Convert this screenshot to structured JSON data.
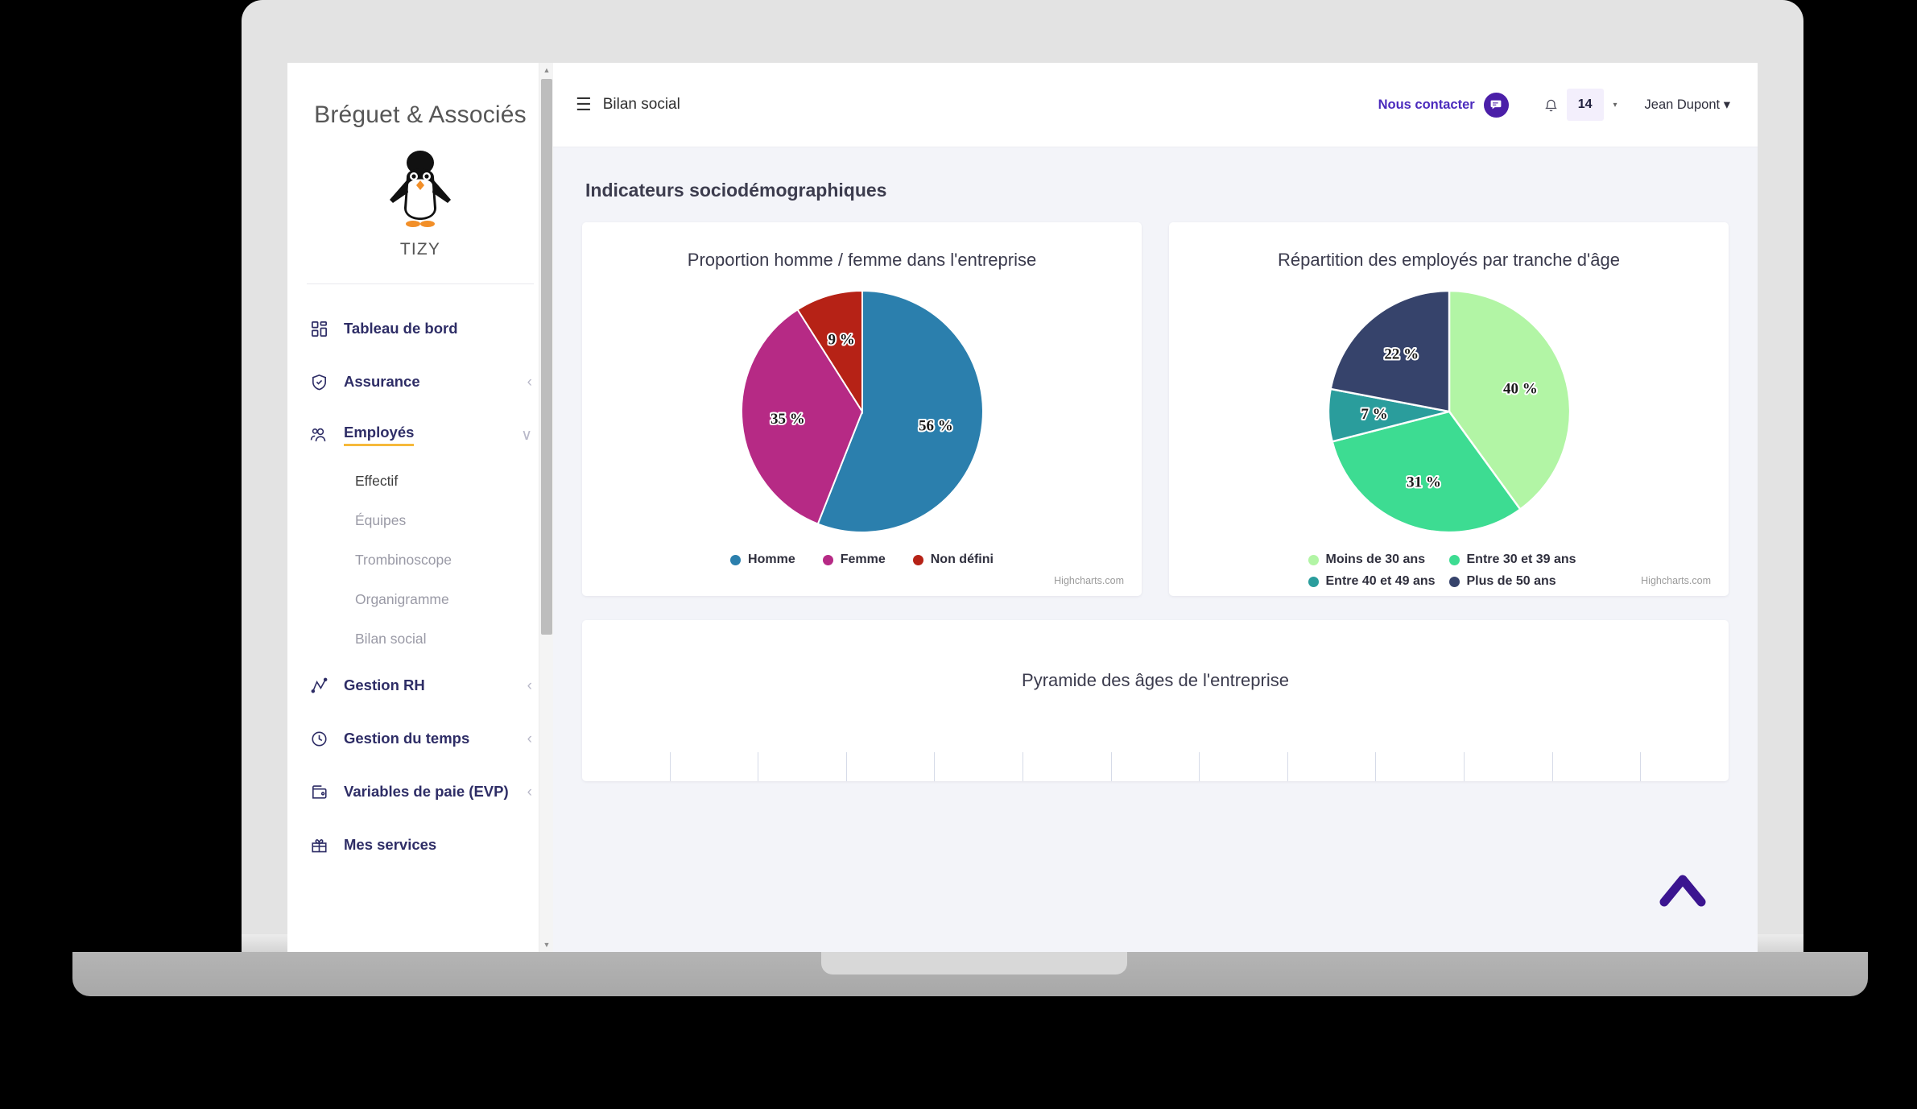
{
  "sidebar": {
    "brand": "Bréguet & Associés",
    "logo_icon": "penguin-logo",
    "company": "TIZY",
    "items": [
      {
        "label": "Tableau de bord",
        "icon": "dashboard-icon",
        "chevron": "",
        "active": false
      },
      {
        "label": "Assurance",
        "icon": "shield-check-icon",
        "chevron": "‹",
        "active": false
      },
      {
        "label": "Employés",
        "icon": "people-icon",
        "chevron": "∨",
        "active": true
      },
      {
        "label": "Gestion RH",
        "icon": "chart-line-icon",
        "chevron": "‹",
        "active": false
      },
      {
        "label": "Gestion du temps",
        "icon": "clock-icon",
        "chevron": "‹",
        "active": false
      },
      {
        "label": "Variables de paie (EVP)",
        "icon": "wallet-icon",
        "chevron": "‹",
        "active": false
      },
      {
        "label": "Mes services",
        "icon": "gift-icon",
        "chevron": "",
        "active": false
      }
    ],
    "subitems": [
      {
        "label": "Effectif",
        "current": true
      },
      {
        "label": "Équipes",
        "current": false
      },
      {
        "label": "Trombinoscope",
        "current": false
      },
      {
        "label": "Organigramme",
        "current": false
      },
      {
        "label": "Bilan social",
        "current": false
      }
    ],
    "scrollbar": {
      "up_arrow": "▲",
      "down_arrow": "▼"
    }
  },
  "topbar": {
    "menu_icon": "hamburger-icon",
    "title": "Bilan social",
    "contact_label": "Nous contacter",
    "contact_icon": "chat-bubble-icon",
    "bell_icon": "bell-icon",
    "notification_count": "14",
    "caret": "▾",
    "user_name": "Jean Dupont",
    "user_caret": "▾"
  },
  "content": {
    "section_title": "Indicateurs sociodémographiques",
    "credits": "Highcharts.com",
    "scroll_top_icon": "chevron-up-icon",
    "pyramid_title": "Pyramide des âges de l'entreprise"
  },
  "chart_data": [
    {
      "type": "pie",
      "title": "Proportion homme / femme dans l'entreprise",
      "categories": [
        "Homme",
        "Femme",
        "Non défini"
      ],
      "values": [
        56,
        35,
        9
      ],
      "labels": [
        "56 %",
        "35 %",
        "9 %"
      ],
      "colors": [
        "#2b7fad",
        "#b62a85",
        "#b62216"
      ],
      "legend_position": "bottom",
      "credits": "Highcharts.com"
    },
    {
      "type": "pie",
      "title": "Répartition des employés par tranche d'âge",
      "categories": [
        "Moins de 30 ans",
        "Entre 30 et 39 ans",
        "Entre 40 et 49 ans",
        "Plus de 50 ans"
      ],
      "values": [
        40,
        31,
        7,
        22
      ],
      "labels": [
        "40 %",
        "31 %",
        "7 %",
        "22 %"
      ],
      "colors": [
        "#b2f5a5",
        "#3ddc92",
        "#2a9d9c",
        "#36436b"
      ],
      "legend_position": "bottom",
      "credits": "Highcharts.com"
    },
    {
      "type": "bar",
      "title": "Pyramide des âges de l'entreprise",
      "categories": [],
      "values": [],
      "grid": true,
      "gridline_count": 13
    }
  ]
}
